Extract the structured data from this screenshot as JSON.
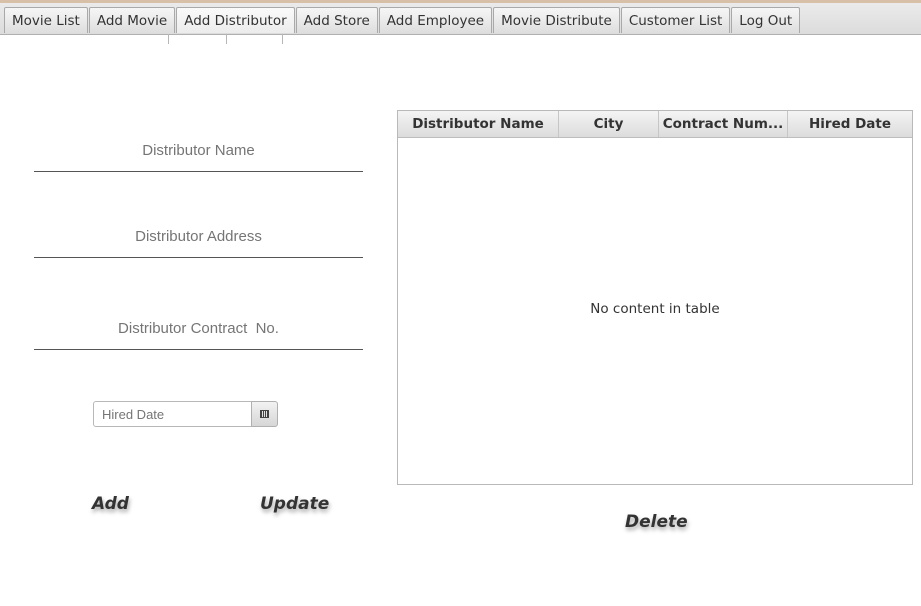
{
  "tabs": [
    {
      "label": "Movie List"
    },
    {
      "label": "Add Movie"
    },
    {
      "label": "Add Distributor",
      "selected": true
    },
    {
      "label": "Add Store"
    },
    {
      "label": "Add Employee"
    },
    {
      "label": "Movie Distribute"
    },
    {
      "label": "Customer List"
    },
    {
      "label": "Log Out"
    }
  ],
  "form": {
    "distributor_name_placeholder": "Distributor Name",
    "distributor_address_placeholder": "Distributor Address",
    "distributor_contract_placeholder": "Distributor Contract  No.",
    "hired_date_placeholder": "Hired Date",
    "calendar_icon": "calendar-icon"
  },
  "actions": {
    "add_label": "Add",
    "update_label": "Update",
    "delete_label": "Delete"
  },
  "table": {
    "columns": [
      "Distributor Name",
      "City",
      "Contract Num...",
      "Hired Date"
    ],
    "rows": [],
    "empty_text": "No content in table"
  }
}
